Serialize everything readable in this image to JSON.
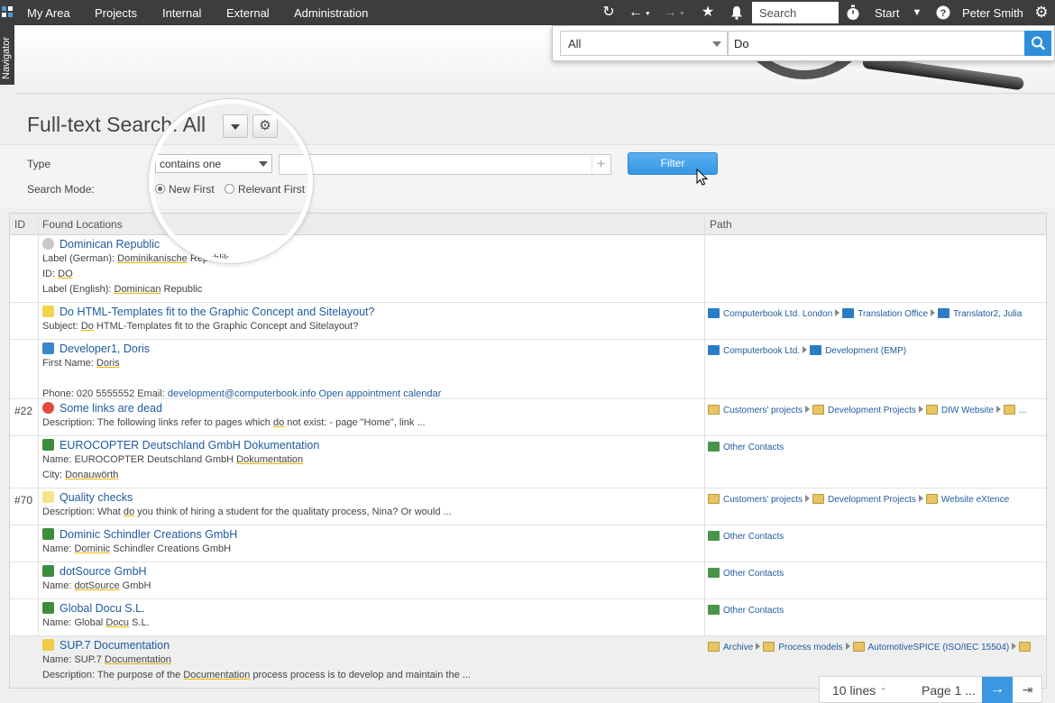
{
  "topbar": {
    "nav": [
      "My Area",
      "Projects",
      "Internal",
      "External",
      "Administration"
    ],
    "search_placeholder": "Search",
    "start_label": "Start",
    "user_name": "Peter Smith"
  },
  "navigator_label": "Navigator",
  "quick_search": {
    "scope": "All",
    "query": "Do"
  },
  "page": {
    "title": "Full-text Search: All"
  },
  "filter": {
    "type_label": "Type",
    "type_value": "contains one",
    "mode_label": "Search Mode:",
    "mode_new": "New First",
    "mode_relevant": "Relevant First",
    "filter_button": "Filter"
  },
  "table": {
    "headers": [
      "ID",
      "Found Locations",
      "Path"
    ],
    "rows": [
      {
        "id": "",
        "title": "Dominican Republic",
        "icon": "circle-icon",
        "details": [
          [
            {
              "t": "Label (German):  "
            },
            {
              "t": "Dominikanische",
              "hl": true
            },
            {
              "t": " Republik"
            }
          ],
          [
            {
              "t": "ID:  "
            },
            {
              "t": "DO",
              "hl": true
            }
          ],
          [
            {
              "t": "Label (English):  "
            },
            {
              "t": "Dominican",
              "hl": true
            },
            {
              "t": " Republic"
            }
          ]
        ],
        "path": []
      },
      {
        "id": "",
        "title": "Do HTML-Templates fit to the Graphic Concept and Sitelayout?",
        "icon": "question-icon",
        "details": [
          [
            {
              "t": "Subject:  "
            },
            {
              "t": "Do",
              "hl": true
            },
            {
              "t": " HTML-Templates fit to the Graphic Concept and Sitelayout?"
            }
          ]
        ],
        "path": [
          "Computerbook Ltd. London",
          "Translation Office",
          "Translator2, Julia"
        ]
      },
      {
        "id": "",
        "title": "Developer1, Doris",
        "icon": "person-icon",
        "details": [
          [
            {
              "t": "First Name:  "
            },
            {
              "t": "Doris",
              "hl": true
            }
          ],
          [],
          [
            {
              "t": "Phone: 020 5555552      Email: "
            },
            {
              "t": "development@computerbook.info",
              "link": true
            },
            {
              "t": "      "
            },
            {
              "t": "Open appointment calendar",
              "link": true
            }
          ]
        ],
        "path": [
          "Computerbook Ltd.",
          "Development (EMP)"
        ]
      },
      {
        "id": "#22",
        "title": "Some links are dead",
        "icon": "error-icon",
        "details": [
          [
            {
              "t": "Description:  The following links refer to pages which "
            },
            {
              "t": "do",
              "hl": true
            },
            {
              "t": " not exist: - page \"Home\", link ..."
            }
          ]
        ],
        "path": [
          "Customers' projects",
          "Development Projects",
          "DIW Website",
          "..."
        ]
      },
      {
        "id": "",
        "title": "EUROCOPTER Deutschland GmbH Dokumentation",
        "icon": "building-icon",
        "details": [
          [
            {
              "t": "Name:  EUROCOPTER Deutschland GmbH "
            },
            {
              "t": "Dokumentation",
              "hl": true
            }
          ],
          [
            {
              "t": "City:  "
            },
            {
              "t": "Donauwörth",
              "hl": true
            }
          ]
        ],
        "path": [
          "Other Contacts"
        ]
      },
      {
        "id": "#70",
        "title": "Quality checks",
        "icon": "bulb-icon",
        "details": [
          [
            {
              "t": "Description:  What "
            },
            {
              "t": "do",
              "hl": true
            },
            {
              "t": " you think of hiring a student for the qualitaty process, Nina? Or would ..."
            }
          ]
        ],
        "path": [
          "Customers' projects",
          "Development Projects",
          "Website eXtence"
        ]
      },
      {
        "id": "",
        "title": "Dominic Schindler Creations GmbH",
        "icon": "building-icon",
        "details": [
          [
            {
              "t": "Name:  "
            },
            {
              "t": "Dominic",
              "hl": true
            },
            {
              "t": " Schindler Creations GmbH"
            }
          ]
        ],
        "path": [
          "Other Contacts"
        ]
      },
      {
        "id": "",
        "title": "dotSource GmbH",
        "icon": "building-icon",
        "details": [
          [
            {
              "t": "Name:  "
            },
            {
              "t": "dotSource",
              "hl": true
            },
            {
              "t": " GmbH"
            }
          ]
        ],
        "path": [
          "Other Contacts"
        ]
      },
      {
        "id": "",
        "title": "Global Docu S.L.",
        "icon": "building-icon",
        "details": [
          [
            {
              "t": "Name:  Global "
            },
            {
              "t": "Docu",
              "hl": true
            },
            {
              "t": " S.L."
            }
          ]
        ],
        "path": [
          "Other Contacts"
        ]
      },
      {
        "id": "",
        "title": "SUP.7 Documentation",
        "icon": "folder-icon",
        "selected": true,
        "details": [
          [
            {
              "t": "Name:  SUP.7 "
            },
            {
              "t": "Documentation",
              "hl": true
            }
          ],
          [
            {
              "t": "Description:  The purpose of the "
            },
            {
              "t": "Documentation",
              "hl": true
            },
            {
              "t": " process process is to develop and maintain the ..."
            }
          ]
        ],
        "path": [
          "Archive",
          "Process models",
          "AutomotiveSPICE (ISO/IEC 15504)",
          ""
        ]
      }
    ]
  },
  "pager": {
    "lines": "10 lines",
    "page": "Page 1 ..."
  }
}
